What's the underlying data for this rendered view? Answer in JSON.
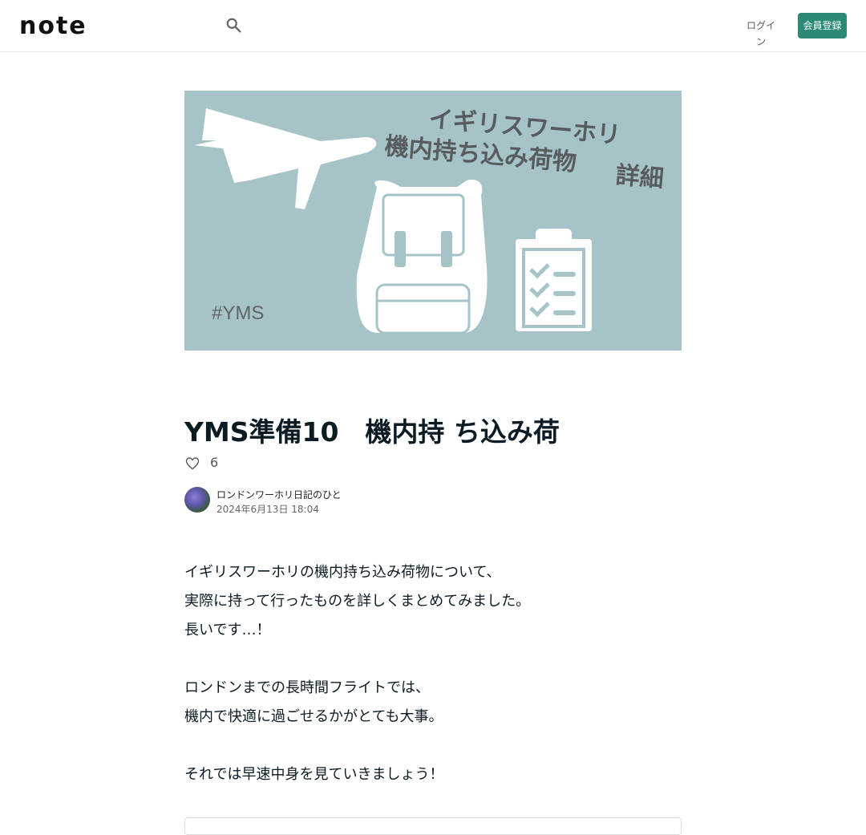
{
  "header": {
    "logo_text": "note",
    "login_label": "ログイン",
    "signup_label": "会員登録"
  },
  "hero": {
    "title_line1": "イギリスワーホリ",
    "title_line2": "機内持ち込み荷物",
    "title_line3": "詳細",
    "hashtag": "#YMS"
  },
  "article": {
    "title": "YMS準備10　機内持 ち込み荷",
    "like_count": "6",
    "author_name": "ロンドンワーホリ日記のひと",
    "date": "2024年6月13日 18:04",
    "paragraphs": [
      "イギリスワーホリの機内持ち込み荷物について、",
      "実際に持って行ったものを詳しくまとめてみました。",
      "長いです…！",
      "",
      "ロンドンまでの長時間フライトでは、",
      "機内で快適に過ごせるかがとても大事。",
      "",
      "それでは早速中身を見ていきましょう！"
    ]
  },
  "colors": {
    "brand": "#2b8a76",
    "hero_bg": "#a6c3c8"
  },
  "icons": [
    "note-logo",
    "search-icon",
    "heart-icon",
    "airplane-icon",
    "backpack-icon",
    "clipboard-icon"
  ]
}
